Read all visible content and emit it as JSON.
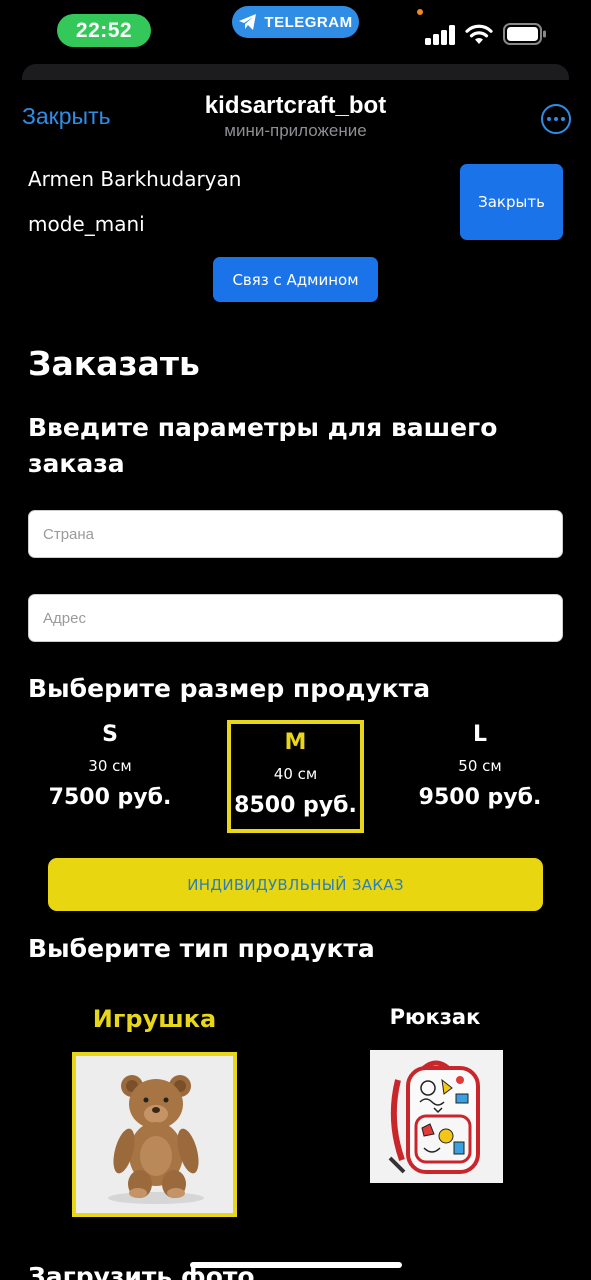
{
  "status_bar": {
    "time": "22:52",
    "telegram_pill": "TELEGRAM",
    "icons": [
      "signal-icon",
      "wifi-icon",
      "battery-icon"
    ]
  },
  "header": {
    "close_label": "Закрыть",
    "title": "kidsartcraft_bot",
    "subtitle": "мини-приложение",
    "more_icon": "more-icon"
  },
  "user": {
    "name": "Armen Barkhudaryan",
    "login": "mode_mani",
    "close_button": "Закрыть",
    "admin_button": "Связ с Админом"
  },
  "order": {
    "title": "Заказать",
    "params_heading": "Введите параметры для вашего заказа",
    "country_placeholder": "Страна",
    "address_placeholder": "Адрес",
    "size_heading": "Выберите размер продукта",
    "sizes": [
      {
        "letter": "S",
        "cm": "30 см",
        "price": "7500 руб.",
        "selected": false
      },
      {
        "letter": "M",
        "cm": "40 см",
        "price": "8500 руб.",
        "selected": true
      },
      {
        "letter": "L",
        "cm": "50 см",
        "price": "9500 руб.",
        "selected": false
      }
    ],
    "custom_order_button": "ИНДИВИДУВЛЬНЫЙ ЗАКАЗ",
    "type_heading": "Выберите тип продукта",
    "types": [
      {
        "label": "Игрушка",
        "image": "teddy-bear-image",
        "selected": true
      },
      {
        "label": "Рюкзак",
        "image": "backpack-image",
        "selected": false
      }
    ],
    "upload_heading": "Загрузить фото"
  },
  "colors": {
    "accent_blue": "#1a73e8",
    "telegram_blue": "#2f8de6",
    "highlight_yellow": "#e8d619",
    "status_green": "#34c759"
  }
}
